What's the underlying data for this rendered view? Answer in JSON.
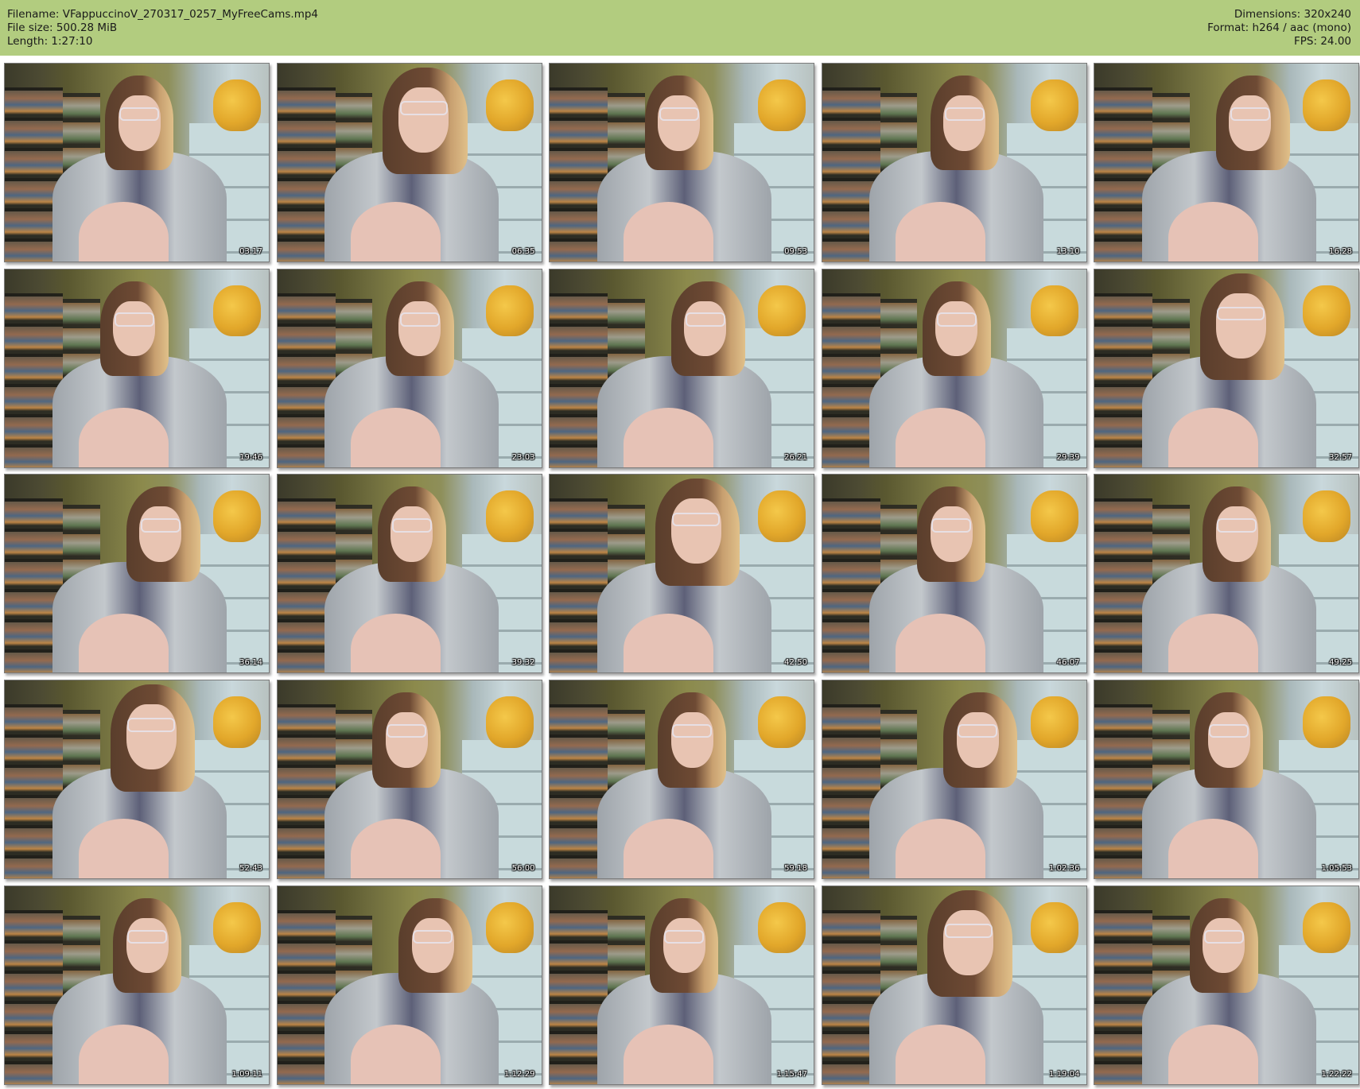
{
  "header": {
    "filename_line": "Filename: VFappuccinoV_270317_0257_MyFreeCams.mp4",
    "filesize_line": "File size: 500.28 MiB",
    "length_line": "Length: 1:27:10",
    "dimensions_line": "Dimensions: 320x240",
    "format_line": "Format: h264 / aac (mono)",
    "fps_line": "FPS: 24.00"
  },
  "colors": {
    "header_bg": "#b2cc7f",
    "page_bg": "#ffffff"
  },
  "thumbnails": [
    {
      "timestamp": "03:17"
    },
    {
      "timestamp": "06:35"
    },
    {
      "timestamp": "09:53"
    },
    {
      "timestamp": "13:10"
    },
    {
      "timestamp": "16:28"
    },
    {
      "timestamp": "19:46"
    },
    {
      "timestamp": "23:03"
    },
    {
      "timestamp": "26:21"
    },
    {
      "timestamp": "29:39"
    },
    {
      "timestamp": "32:57"
    },
    {
      "timestamp": "36:14"
    },
    {
      "timestamp": "39:32"
    },
    {
      "timestamp": "42:50"
    },
    {
      "timestamp": "46:07"
    },
    {
      "timestamp": "49:25"
    },
    {
      "timestamp": "52:43"
    },
    {
      "timestamp": "56:00"
    },
    {
      "timestamp": "59:18"
    },
    {
      "timestamp": "1:02:36"
    },
    {
      "timestamp": "1:05:53"
    },
    {
      "timestamp": "1:09:11"
    },
    {
      "timestamp": "1:12:29"
    },
    {
      "timestamp": "1:15:47"
    },
    {
      "timestamp": "1:19:04"
    },
    {
      "timestamp": "1:22:22"
    }
  ]
}
